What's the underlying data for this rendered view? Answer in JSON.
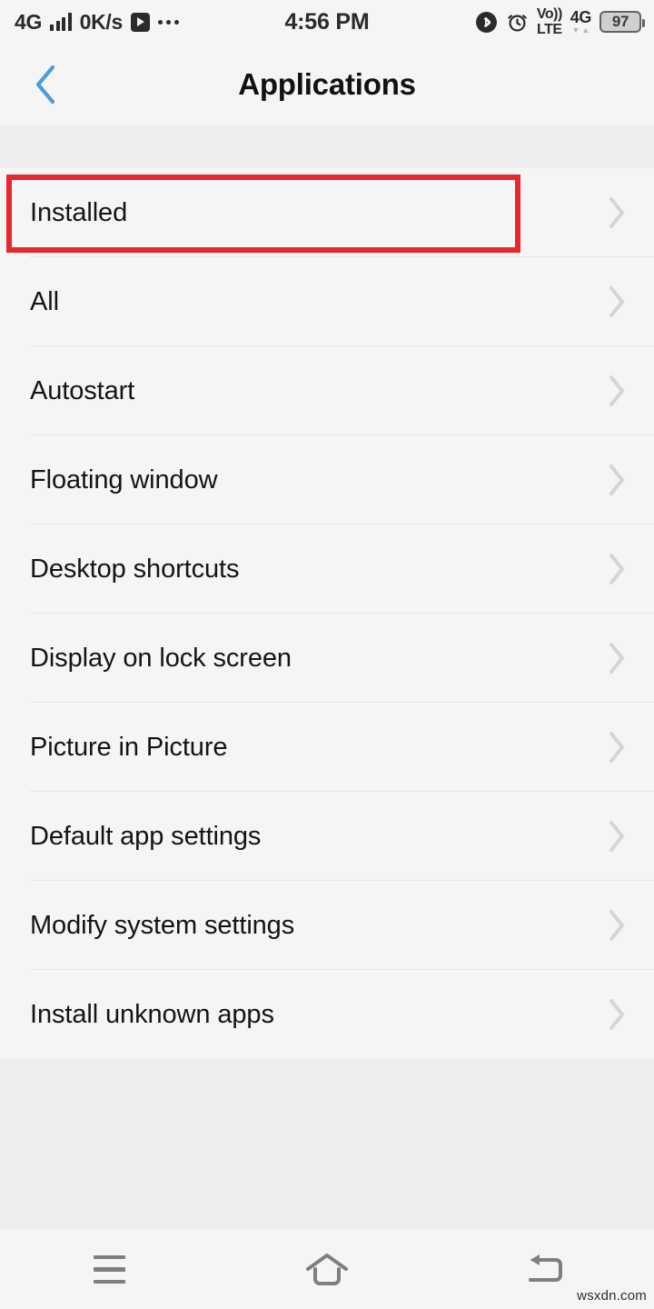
{
  "status_bar": {
    "network_type": "4G",
    "data_rate": "0K/s",
    "clock": "4:56 PM",
    "volte_top": "Vo))",
    "volte_bottom": "LTE",
    "network_right": "4G",
    "battery_level": "97",
    "icons": {
      "signal": "signal-bars-icon",
      "media": "play-badge-icon",
      "overflow": "more-dots-icon",
      "bluetooth": "bluetooth-icon",
      "alarm": "alarm-clock-icon",
      "data_up": "▲",
      "data_down": "▼"
    }
  },
  "header": {
    "title": "Applications",
    "back_icon": "chevron-left-icon",
    "back_color": "#4a9ede"
  },
  "list": {
    "chevron_icon": "chevron-right-icon",
    "items": [
      {
        "label": "Installed",
        "highlighted": true
      },
      {
        "label": "All",
        "highlighted": false
      },
      {
        "label": "Autostart",
        "highlighted": false
      },
      {
        "label": "Floating window",
        "highlighted": false
      },
      {
        "label": "Desktop shortcuts",
        "highlighted": false
      },
      {
        "label": "Display on lock screen",
        "highlighted": false
      },
      {
        "label": "Picture in Picture",
        "highlighted": false
      },
      {
        "label": "Default app settings",
        "highlighted": false
      },
      {
        "label": "Modify system settings",
        "highlighted": false
      },
      {
        "label": "Install unknown apps",
        "highlighted": false
      }
    ]
  },
  "highlight": {
    "color": "#e8262d",
    "target": "Installed"
  },
  "nav_bar": {
    "menu_icon": "menu-icon",
    "home_icon": "home-icon",
    "back_icon": "back-arrow-icon"
  },
  "watermark": {
    "text": "wsxdn.com"
  },
  "theme": {
    "page_background": "#f5f5f5",
    "spacer_background": "#eeeeee",
    "divider": "#e6e6e6",
    "chevron": "#d5d5d5",
    "text_primary": "#141414",
    "nav_icon": "#7f7f7f"
  }
}
